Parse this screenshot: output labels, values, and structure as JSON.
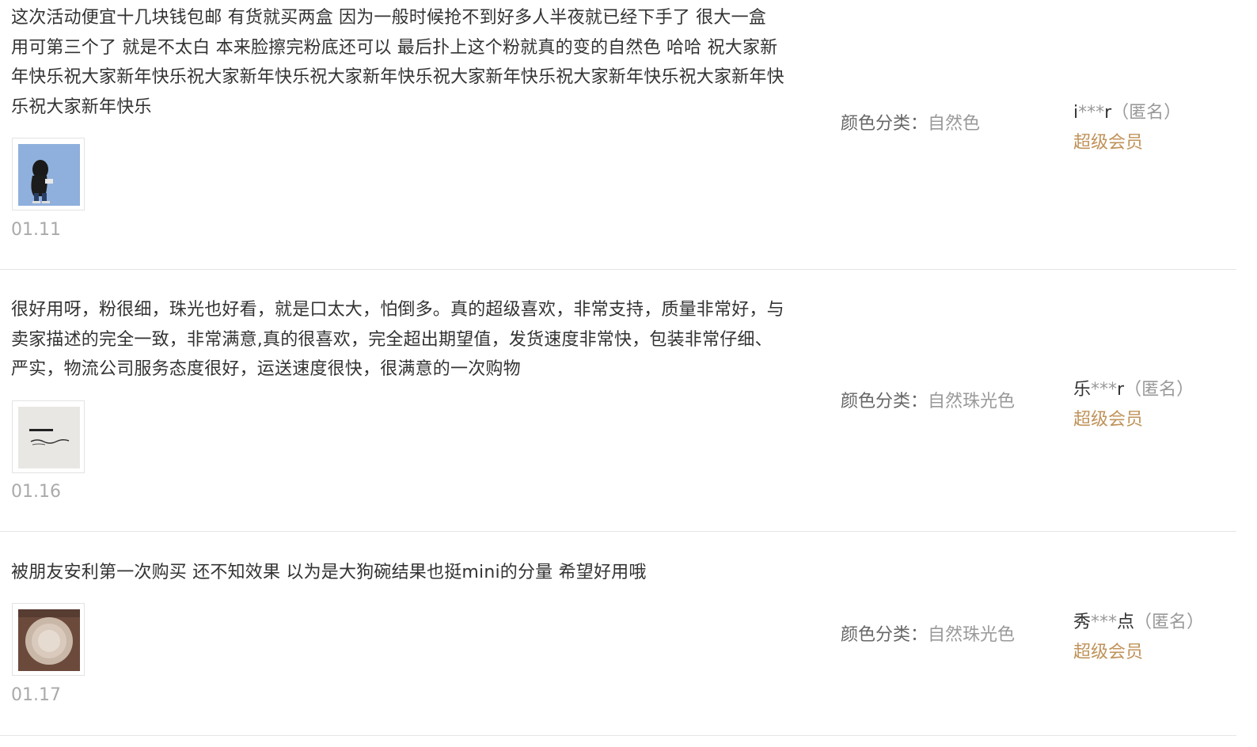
{
  "reviews": [
    {
      "content": "这次活动便宜十几块钱包邮 有货就买两盒 因为一般时候抢不到好多人半夜就已经下手了 很大一盒 用可第三个了 就是不太白 本来脸擦完粉底还可以 最后扑上这个粉就真的变的自然色 哈哈 祝大家新年快乐祝大家新年快乐祝大家新年快乐祝大家新年快乐祝大家新年快乐祝大家新年快乐祝大家新年快乐祝大家新年快乐",
      "date": "01.11",
      "sku_label": "颜色分类：",
      "sku_value": "自然色",
      "user_first": "i",
      "user_mask": "***",
      "user_last": "r",
      "anon": "（匿名）",
      "member": "超级会员",
      "thumb_icon": "photo-figure-on-blue"
    },
    {
      "content": "很好用呀，粉很细，珠光也好看，就是口太大，怕倒多。真的超级喜欢，非常支持，质量非常好，与卖家描述的完全一致，非常满意,真的很喜欢，完全超出期望值，发货速度非常快，包装非常仔细、严实，物流公司服务态度很好，运送速度很快，很满意的一次购物",
      "date": "01.16",
      "sku_label": "颜色分类：",
      "sku_value": "自然珠光色",
      "user_first": "乐",
      "user_mask": "***",
      "user_last": "r",
      "anon": "（匿名）",
      "member": "超级会员",
      "thumb_icon": "photo-handwritten-note"
    },
    {
      "content": "被朋友安利第一次购买 还不知效果 以为是大狗碗结果也挺mini的分量 希望好用哦",
      "date": "01.17",
      "sku_label": "颜色分类：",
      "sku_value": "自然珠光色",
      "user_first": "秀",
      "user_mask": "***",
      "user_last": "点",
      "anon": "（匿名）",
      "member": "超级会员",
      "thumb_icon": "photo-powder-compact"
    }
  ]
}
